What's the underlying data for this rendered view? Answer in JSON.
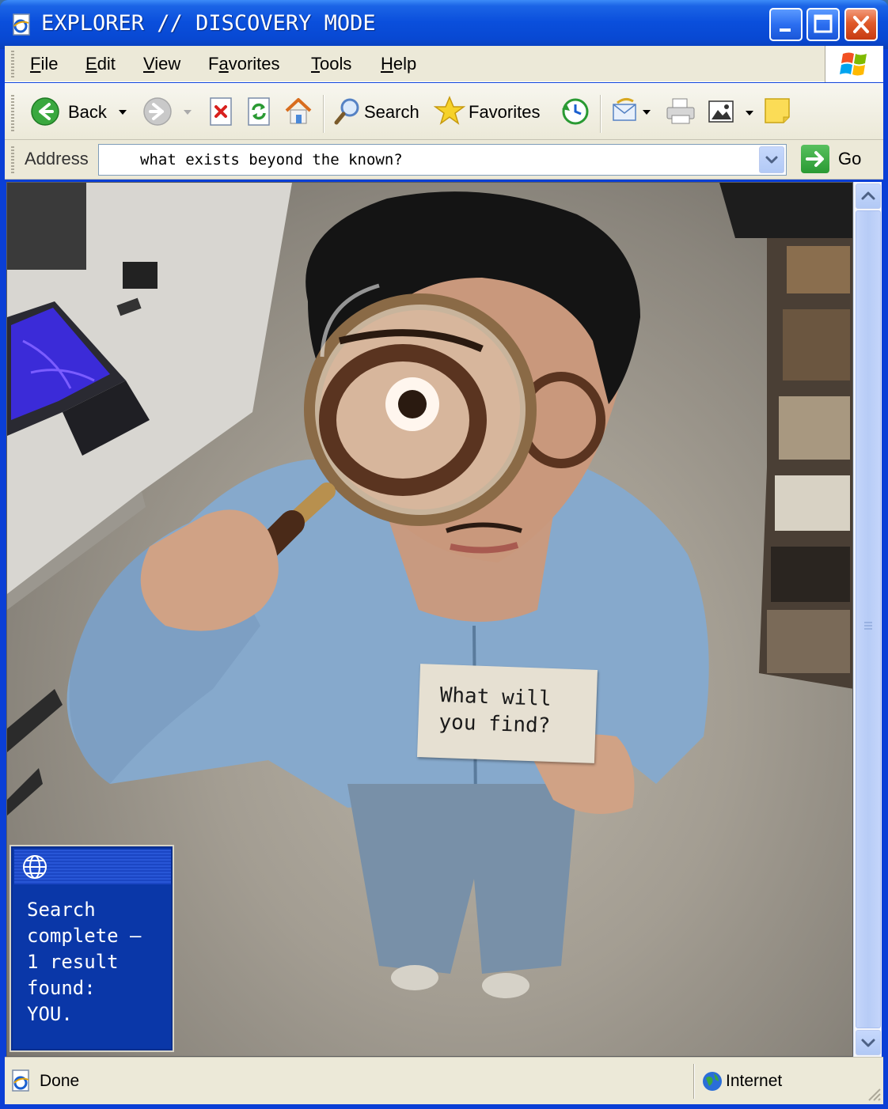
{
  "window": {
    "title": "EXPLORER // DISCOVERY MODE"
  },
  "menu": {
    "items": [
      {
        "label": "File",
        "accel": "F",
        "rest": "ile"
      },
      {
        "label": "Edit",
        "accel": "E",
        "rest": "dit"
      },
      {
        "label": "View",
        "accel": "V",
        "rest": "iew"
      },
      {
        "label": "Favorites",
        "accel": "a",
        "pre": "F",
        "rest": "vorites"
      },
      {
        "label": "Tools",
        "accel": "T",
        "rest": "ools"
      },
      {
        "label": "Help",
        "accel": "H",
        "rest": "elp"
      }
    ]
  },
  "toolbar": {
    "back_label": "Back",
    "search_label": "Search",
    "favorites_label": "Favorites"
  },
  "address": {
    "label": "Address",
    "value": "what exists beyond the known?",
    "go_label": "Go"
  },
  "content": {
    "card_text": "What will\nyou find?"
  },
  "popup": {
    "message": "Search\ncomplete —\n1 result\nfound:\nYOU."
  },
  "status": {
    "left": "Done",
    "zone": "Internet"
  },
  "colors": {
    "titlebar": "#0a4fdc",
    "chrome": "#ece9d8",
    "popup": "#0a37a8",
    "close": "#e05a2a"
  }
}
